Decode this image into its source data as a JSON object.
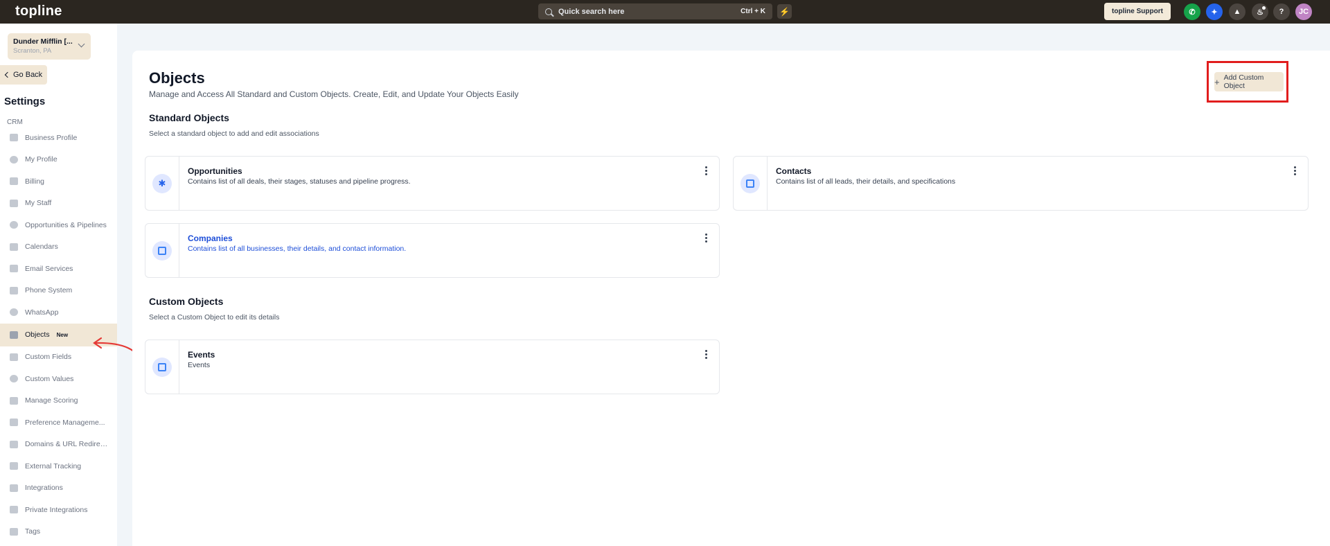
{
  "topbar": {
    "logo": "topline",
    "search_placeholder": "Quick search here",
    "search_shortcut": "Ctrl + K",
    "support_label": "topline Support",
    "avatar_initials": "JC",
    "help_label": "?"
  },
  "sidebar": {
    "location_name": "Dunder Mifflin [...",
    "location_sub": "Scranton, PA",
    "go_back": "Go Back",
    "settings_title": "Settings",
    "section": "CRM",
    "items": [
      {
        "label": "Business Profile",
        "icon": "briefcase-icon"
      },
      {
        "label": "My Profile",
        "icon": "user-icon"
      },
      {
        "label": "Billing",
        "icon": "billing-icon"
      },
      {
        "label": "My Staff",
        "icon": "staff-icon"
      },
      {
        "label": "Opportunities & Pipelines",
        "icon": "pipeline-icon"
      },
      {
        "label": "Calendars",
        "icon": "calendar-icon"
      },
      {
        "label": "Email Services",
        "icon": "email-icon"
      },
      {
        "label": "Phone System",
        "icon": "phone-icon"
      },
      {
        "label": "WhatsApp",
        "icon": "whatsapp-icon"
      },
      {
        "label": "Objects",
        "icon": "objects-icon",
        "badge": "New"
      },
      {
        "label": "Custom Fields",
        "icon": "custom-fields-icon"
      },
      {
        "label": "Custom Values",
        "icon": "custom-values-icon"
      },
      {
        "label": "Manage Scoring",
        "icon": "scoring-icon"
      },
      {
        "label": "Preference Manageme...",
        "icon": "preference-icon"
      },
      {
        "label": "Domains & URL Redirec...",
        "icon": "domains-icon"
      },
      {
        "label": "External Tracking",
        "icon": "tracking-icon"
      },
      {
        "label": "Integrations",
        "icon": "integrations-icon"
      },
      {
        "label": "Private Integrations",
        "icon": "private-integrations-icon"
      },
      {
        "label": "Tags",
        "icon": "tag-icon"
      }
    ]
  },
  "main": {
    "title": "Objects",
    "subtitle": "Manage and Access All Standard and Custom Objects. Create, Edit, and Update Your Objects Easily",
    "add_button": "Add Custom Object",
    "standard": {
      "title": "Standard Objects",
      "subtitle": "Select a standard object to add and edit associations",
      "cards": [
        {
          "title": "Opportunities",
          "desc": "Contains list of all deals, their stages, statuses and pipeline progress."
        },
        {
          "title": "Contacts",
          "desc": "Contains list of all leads, their details, and specifications"
        },
        {
          "title": "Companies",
          "desc": "Contains list of all businesses, their details, and contact information."
        }
      ]
    },
    "custom": {
      "title": "Custom Objects",
      "subtitle": "Select a Custom Object to edit its details",
      "cards": [
        {
          "title": "Events",
          "desc": "Events"
        }
      ]
    }
  },
  "colors": {
    "topbar_bg": "#2b2620",
    "accent_beige": "#f1e7d6",
    "highlight_red": "#e11d1d",
    "link_blue": "#1d4ed8"
  }
}
